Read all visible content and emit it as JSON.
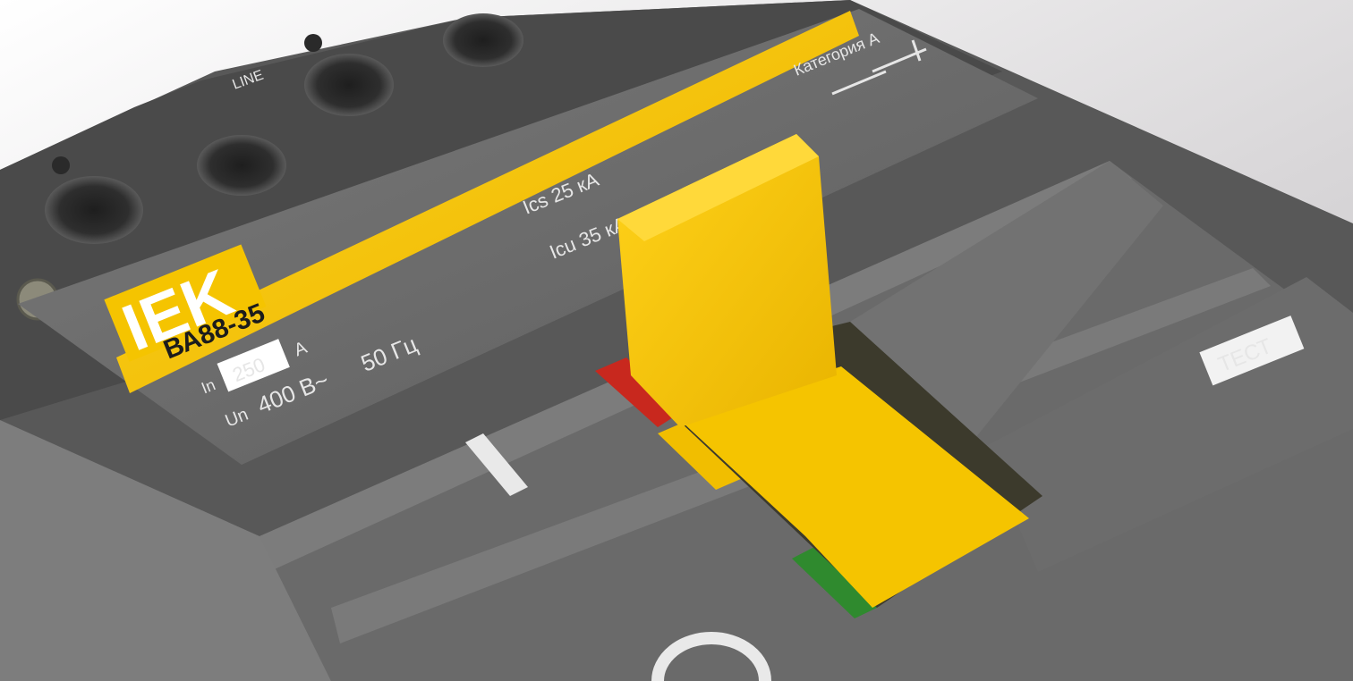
{
  "photo": {
    "subject": "Автоматический выключатель IEK ВА88-35",
    "colors": {
      "body": "#6e6e6e",
      "body_dark": "#4f4f4f",
      "accent_yellow": "#f5c400",
      "on_red": "#c8281e",
      "off_green": "#2f8a2e",
      "background": "#d8d6d8"
    }
  },
  "label": {
    "brand": "IEK",
    "model": "ВА88-35",
    "in_symbol": "In",
    "in_value": "250",
    "in_unit": "А",
    "un_symbol": "Un",
    "voltage": "400 В~",
    "frequency": "50 Гц",
    "ics": "Ics 25 кА",
    "icu": "Icu 35 кА",
    "category": "Категория А",
    "terminal_mark": "LINE"
  },
  "controls": {
    "on_mark": "I",
    "off_mark": "O",
    "test_button": "ТЕСТ"
  }
}
